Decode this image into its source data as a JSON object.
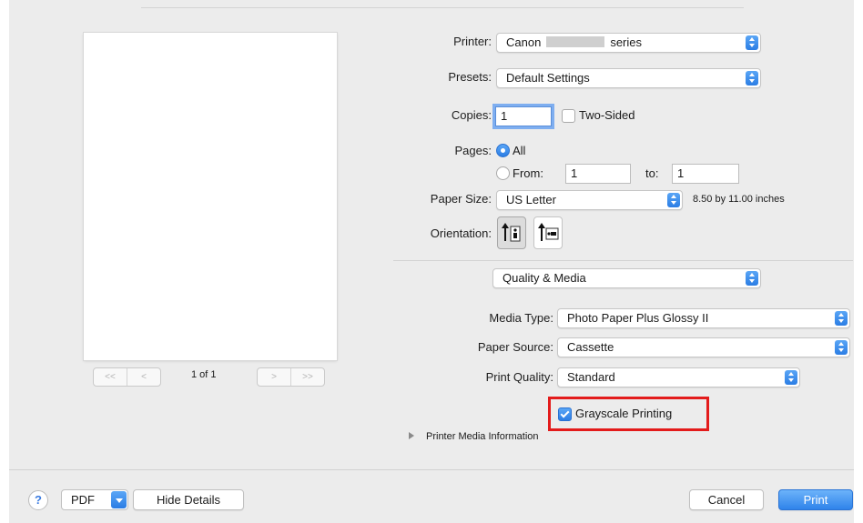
{
  "preview": {
    "page_indicator": "1 of 1",
    "first_glyph": "<<",
    "prev_glyph": "<",
    "next_glyph": ">",
    "last_glyph": ">>"
  },
  "printer": {
    "label": "Printer:",
    "value_prefix": "Canon",
    "value_suffix": "series"
  },
  "presets": {
    "label": "Presets:",
    "value": "Default Settings"
  },
  "copies": {
    "label": "Copies:",
    "value": "1",
    "two_sided_label": "Two-Sided",
    "two_sided_checked": false
  },
  "pages": {
    "label": "Pages:",
    "all_label": "All",
    "all_selected": true,
    "from_label": "From:",
    "from_value": "1",
    "to_label": "to:",
    "to_value": "1"
  },
  "paper_size": {
    "label": "Paper Size:",
    "value": "US Letter",
    "dimensions": "8.50 by 11.00 inches"
  },
  "orientation": {
    "label": "Orientation:",
    "selected": "portrait"
  },
  "section": {
    "value": "Quality & Media"
  },
  "media_type": {
    "label": "Media Type:",
    "value": "Photo Paper Plus Glossy II"
  },
  "paper_source": {
    "label": "Paper Source:",
    "value": "Cassette"
  },
  "print_quality": {
    "label": "Print Quality:",
    "value": "Standard"
  },
  "grayscale": {
    "label": "Grayscale Printing",
    "checked": true
  },
  "media_info": {
    "label": "Printer Media Information"
  },
  "footer": {
    "help_glyph": "?",
    "pdf_label": "PDF",
    "hide_details_label": "Hide Details",
    "cancel_label": "Cancel",
    "print_label": "Print"
  },
  "colors": {
    "accent": "#2b7de4",
    "highlight_box": "#e31b1b",
    "panel_bg": "#ececec"
  }
}
